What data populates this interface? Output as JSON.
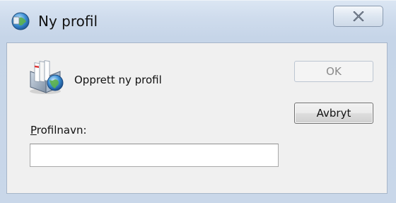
{
  "window": {
    "title": "Ny profil",
    "title_icon": "mail-globe-icon",
    "close_icon": "close-icon"
  },
  "dialog": {
    "heading": "Opprett ny profil",
    "heading_icon": "mail-server-icon",
    "field": {
      "label_accel": "P",
      "label_rest": "rofilnavn:",
      "value": "",
      "placeholder": ""
    },
    "buttons": {
      "ok": "OK",
      "cancel": "Avbryt"
    }
  }
}
